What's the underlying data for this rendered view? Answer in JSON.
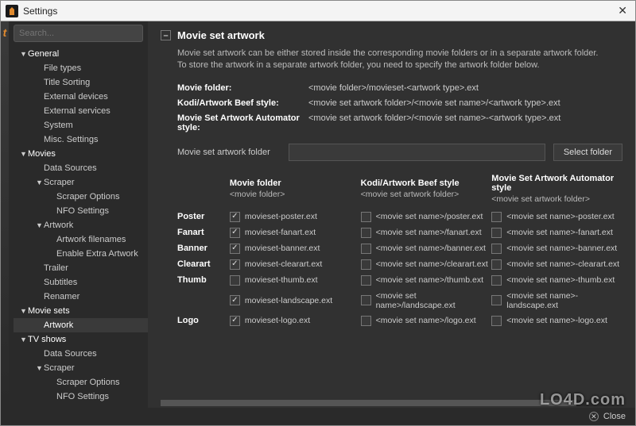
{
  "window": {
    "title": "Settings",
    "close_label": "✕"
  },
  "search": {
    "placeholder": "Search..."
  },
  "tree": [
    {
      "level": 1,
      "label": "General",
      "caret": "▼"
    },
    {
      "level": 2,
      "label": "File types"
    },
    {
      "level": 2,
      "label": "Title Sorting"
    },
    {
      "level": 2,
      "label": "External devices"
    },
    {
      "level": 2,
      "label": "External services"
    },
    {
      "level": 2,
      "label": "System"
    },
    {
      "level": 2,
      "label": "Misc. Settings"
    },
    {
      "level": 1,
      "label": "Movies",
      "caret": "▼"
    },
    {
      "level": 2,
      "label": "Data Sources"
    },
    {
      "level": 2,
      "label": "Scraper",
      "caret": "▼"
    },
    {
      "level": 3,
      "label": "Scraper Options"
    },
    {
      "level": 3,
      "label": "NFO Settings"
    },
    {
      "level": 2,
      "label": "Artwork",
      "caret": "▼"
    },
    {
      "level": 3,
      "label": "Artwork filenames"
    },
    {
      "level": 3,
      "label": "Enable Extra Artwork"
    },
    {
      "level": 2,
      "label": "Trailer"
    },
    {
      "level": 2,
      "label": "Subtitles"
    },
    {
      "level": 2,
      "label": "Renamer"
    },
    {
      "level": 1,
      "label": "Movie sets",
      "caret": "▼"
    },
    {
      "level": 2,
      "label": "Artwork",
      "selected": true
    },
    {
      "level": 1,
      "label": "TV shows",
      "caret": "▼"
    },
    {
      "level": 2,
      "label": "Data Sources"
    },
    {
      "level": 2,
      "label": "Scraper",
      "caret": "▼"
    },
    {
      "level": 3,
      "label": "Scraper Options"
    },
    {
      "level": 3,
      "label": "NFO Settings"
    }
  ],
  "section": {
    "title": "Movie set artwork",
    "expand": "–",
    "desc1": "Movie set artwork can be either stored inside the corresponding movie folders or in a separate artwork folder.",
    "desc2": "To store the artwork in a separate artwork folder, you need to specify the artwork folder below."
  },
  "paths": [
    {
      "label": "Movie folder:",
      "value": "<movie folder>/movieset-<artwork type>.ext"
    },
    {
      "label": "Kodi/Artwork Beef style:",
      "value": "<movie set artwork folder>/<movie set name>/<artwork type>.ext"
    },
    {
      "label": "Movie Set Artwork Automator style:",
      "value": "<movie set artwork folder>/<movie set name>-<artwork type>.ext"
    }
  ],
  "folder": {
    "label": "Movie set artwork folder",
    "value": "",
    "button": "Select folder"
  },
  "columns": [
    {
      "h1": "Movie folder",
      "h2": "<movie folder>"
    },
    {
      "h1": "Kodi/Artwork Beef style",
      "h2": "<movie set artwork folder>"
    },
    {
      "h1": "Movie Set Artwork Automator style",
      "h2": "<movie set artwork folder>"
    }
  ],
  "rows": [
    {
      "label": "Poster",
      "cells": [
        {
          "c": true,
          "t": "movieset-poster.ext"
        },
        {
          "c": false,
          "t": "<movie set name>/poster.ext"
        },
        {
          "c": false,
          "t": "<movie set name>-poster.ext"
        }
      ]
    },
    {
      "label": "Fanart",
      "cells": [
        {
          "c": true,
          "t": "movieset-fanart.ext"
        },
        {
          "c": false,
          "t": "<movie set name>/fanart.ext"
        },
        {
          "c": false,
          "t": "<movie set name>-fanart.ext"
        }
      ]
    },
    {
      "label": "Banner",
      "cells": [
        {
          "c": true,
          "t": "movieset-banner.ext"
        },
        {
          "c": false,
          "t": "<movie set name>/banner.ext"
        },
        {
          "c": false,
          "t": "<movie set name>-banner.ext"
        }
      ]
    },
    {
      "label": "Clearart",
      "cells": [
        {
          "c": true,
          "t": "movieset-clearart.ext"
        },
        {
          "c": false,
          "t": "<movie set name>/clearart.ext"
        },
        {
          "c": false,
          "t": "<movie set name>-clearart.ext"
        }
      ]
    },
    {
      "label": "Thumb",
      "cells": [
        {
          "c": false,
          "t": "movieset-thumb.ext"
        },
        {
          "c": false,
          "t": "<movie set name>/thumb.ext"
        },
        {
          "c": false,
          "t": "<movie set name>-thumb.ext"
        }
      ]
    },
    {
      "label": "",
      "cells": [
        {
          "c": true,
          "t": "movieset-landscape.ext"
        },
        {
          "c": false,
          "t": "<movie set name>/landscape.ext"
        },
        {
          "c": false,
          "t": "<movie set name>-landscape.ext"
        }
      ]
    },
    {
      "label": "Logo",
      "cells": [
        {
          "c": true,
          "t": "movieset-logo.ext"
        },
        {
          "c": false,
          "t": "<movie set name>/logo.ext"
        },
        {
          "c": false,
          "t": "<movie set name>-logo.ext"
        }
      ]
    }
  ],
  "footer": {
    "close": "Close"
  },
  "watermark": "LO4D.com"
}
